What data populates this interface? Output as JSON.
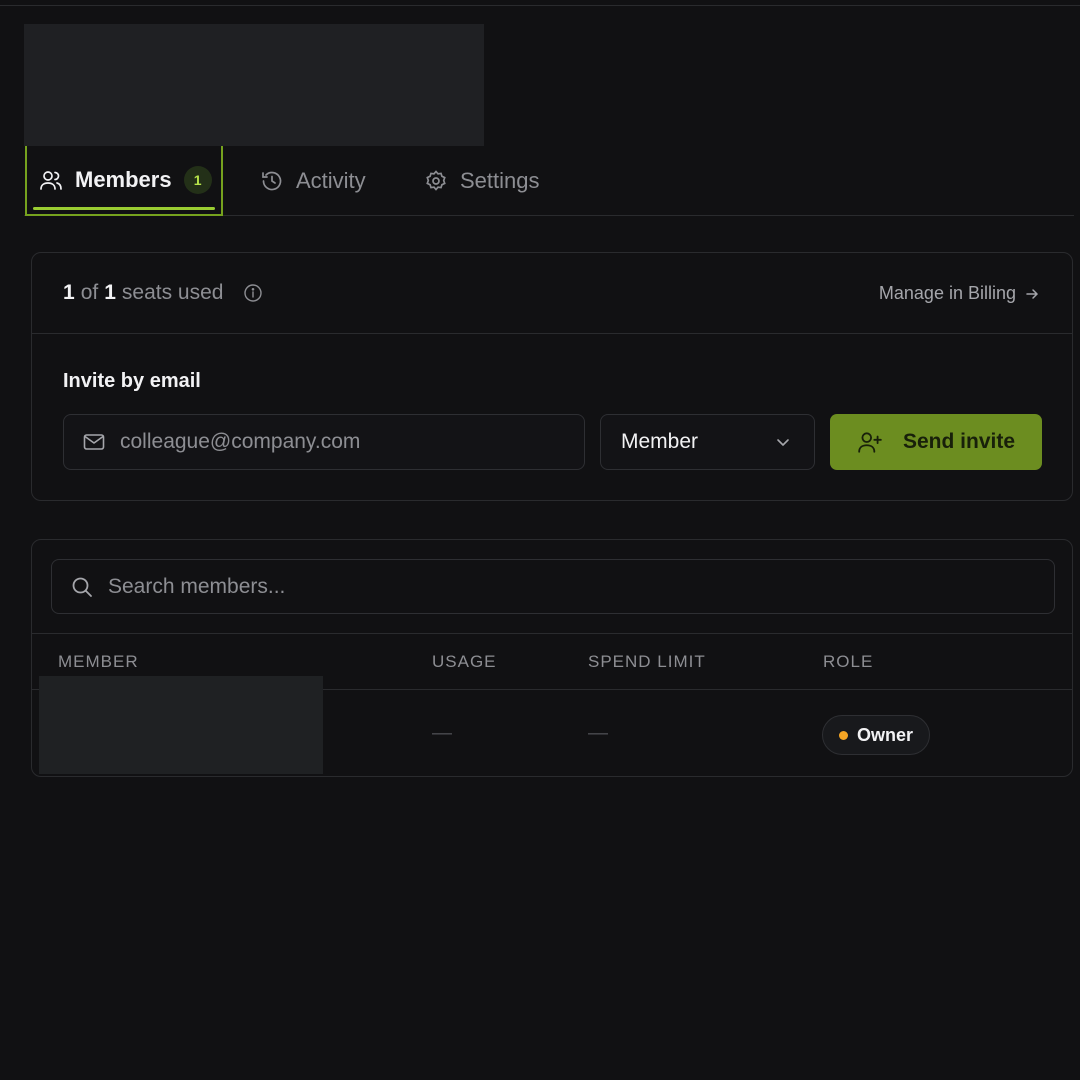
{
  "tabs": [
    {
      "label": "Members",
      "badge": "1",
      "icon": "users-icon",
      "active": true
    },
    {
      "label": "Activity",
      "icon": "history-icon"
    },
    {
      "label": "Settings",
      "icon": "gear-icon"
    }
  ],
  "seats": {
    "used": "1",
    "of": "of",
    "total": "1",
    "suffix": "seats used",
    "billing_link": "Manage in Billing"
  },
  "invite": {
    "title": "Invite by email",
    "email_placeholder": "colleague@company.com",
    "role_value": "Member",
    "send_label": "Send invite"
  },
  "members": {
    "search_placeholder": "Search members...",
    "columns": [
      "MEMBER",
      "USAGE",
      "SPEND LIMIT",
      "ROLE"
    ],
    "rows": [
      {
        "usage": "—",
        "spend_limit": "—",
        "role": "Owner"
      }
    ]
  },
  "colors": {
    "accent": "#9acd32",
    "button": "#6c8d20",
    "owner_dot": "#f5a524",
    "background": "#111113"
  }
}
